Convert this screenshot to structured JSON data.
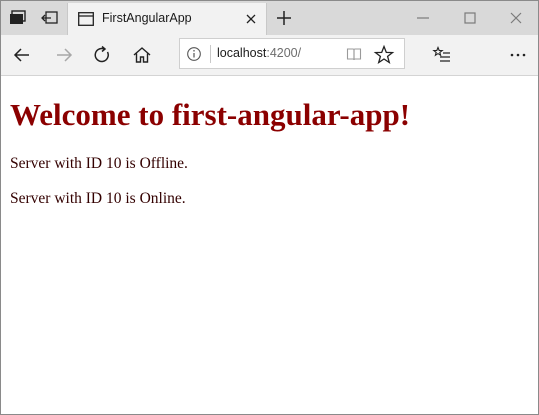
{
  "browser": {
    "tab": {
      "title": "FirstAngularApp"
    },
    "address_bar": {
      "host": "localhost",
      "rest": ":4200/"
    }
  },
  "page": {
    "heading": "Welcome to first-angular-app!",
    "servers": [
      {
        "text": "Server with ID 10 is Offline."
      },
      {
        "text": "Server with ID 10 is Online."
      }
    ]
  },
  "icons": {
    "tab_actions": "tab-actions-icon",
    "set_aside": "set-aside-tabs-icon",
    "favicon": "page-favicon-icon",
    "close": "close-tab-icon",
    "new_tab": "new-tab-icon",
    "minimize": "minimize-icon",
    "maximize": "maximize-icon",
    "close_window": "close-window-icon",
    "back": "back-arrow-icon",
    "forward": "forward-arrow-icon",
    "refresh": "refresh-icon",
    "home": "home-icon",
    "info": "info-icon",
    "reading_view": "reading-view-icon",
    "favorite": "star-icon",
    "favorites_hub": "favorites-hub-icon",
    "more": "more-icon"
  },
  "colors": {
    "heading": "#8b0000",
    "body_text": "#330000",
    "tabbar_bg": "#d9d9d9",
    "toolbar_bg": "#f2f2f2"
  }
}
